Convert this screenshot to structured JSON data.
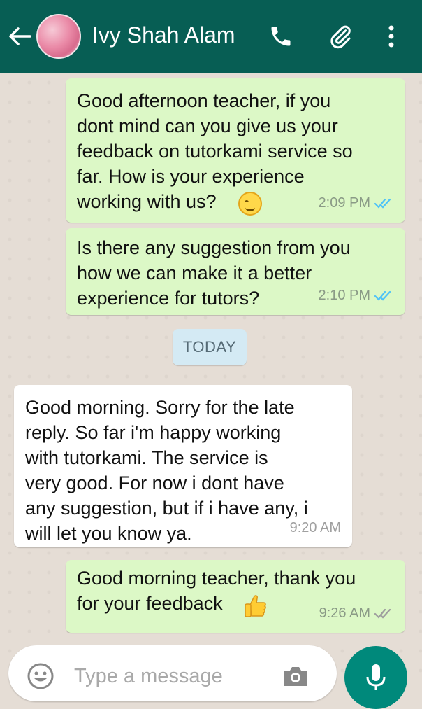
{
  "header": {
    "contact_name": "Ivy Shah Alam",
    "icons": [
      "back-arrow-icon",
      "phone-icon",
      "paperclip-icon",
      "more-vert-icon"
    ],
    "color": "#075e54"
  },
  "messages": [
    {
      "dir": "out",
      "text": "Good afternoon teacher, if you\ndont mind can you give us your\nfeedback on tutorkami service so\nfar. How is your experience\nworking with us?",
      "emoji": "smiling-face-emoji",
      "time": "2:09 PM",
      "ticks": "read"
    },
    {
      "dir": "out",
      "text": "Is there any suggestion from you\nhow we can make it a better\nexperience for tutors?",
      "time": "2:10 PM",
      "ticks": "read"
    },
    {
      "dir": "in",
      "text": "Good morning. Sorry for the late\nreply. So far i'm happy working\nwith tutorkami. The service is\nvery good. For now i dont have\nany suggestion, but if i have any, i\nwill let you know ya.",
      "time": "9:20 AM"
    },
    {
      "dir": "out",
      "text": "Good morning teacher, thank you\nfor your feedback",
      "emoji": "thumbs-up-emoji",
      "time": "9:26 AM",
      "ticks": "delivered"
    }
  ],
  "date_separator": "TODAY",
  "input": {
    "placeholder": "Type a message"
  },
  "colors": {
    "outgoing_bubble": "#dcf8c6",
    "incoming_bubble": "#ffffff",
    "read_tick": "#4fc3f7",
    "delivered_tick": "#9e9e9e",
    "mic_button": "#00897b"
  }
}
